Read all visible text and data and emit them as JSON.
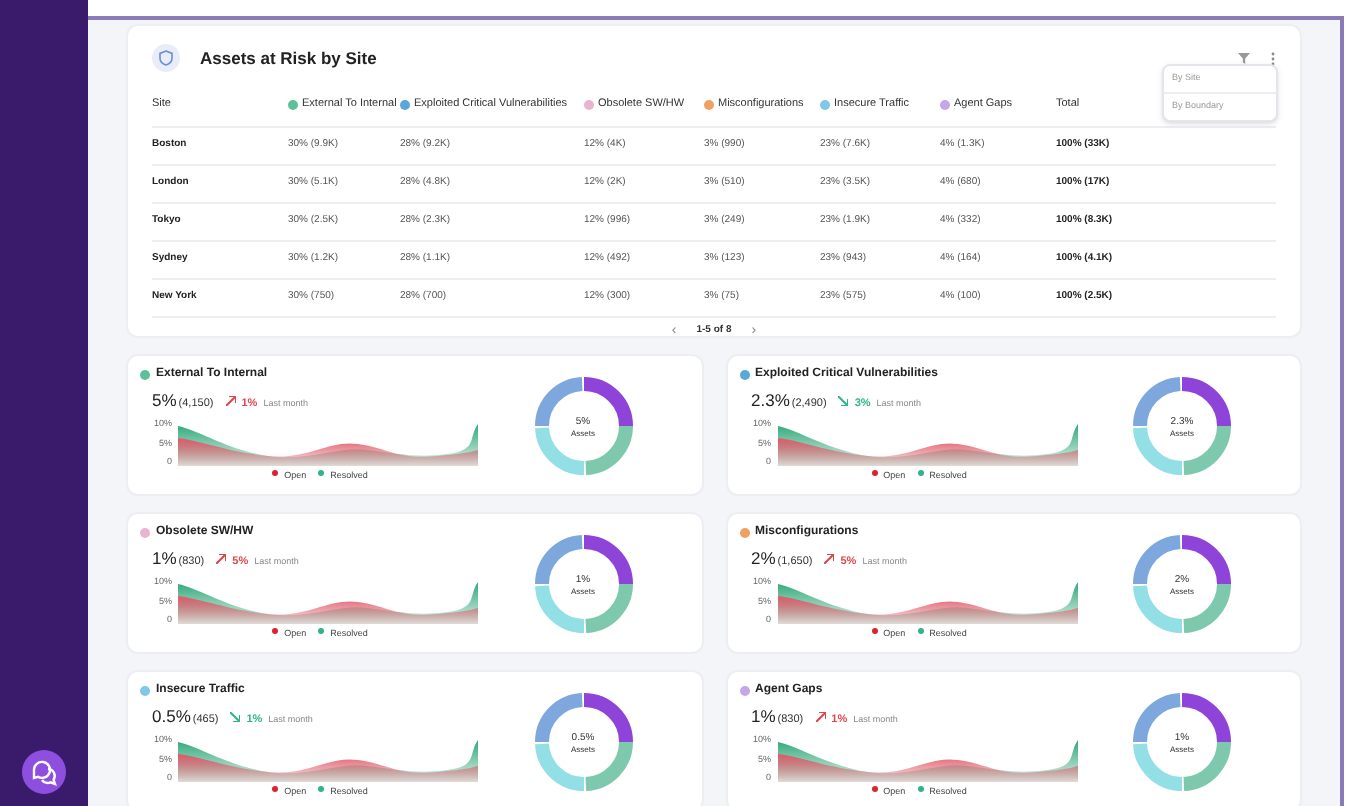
{
  "table_card": {
    "title": "Assets at Risk by Site",
    "columns": [
      {
        "label": "Site"
      },
      {
        "label": "External To Internal",
        "color": "#5cc19a"
      },
      {
        "label": "Exploited Critical Vulnerabilities",
        "color": "#5aa7d8"
      },
      {
        "label": "Obsolete SW/HW",
        "color": "#e8b4d0"
      },
      {
        "label": "Misconfigurations",
        "color": "#f0a060"
      },
      {
        "label": "Insecure Traffic",
        "color": "#7fc8e8"
      },
      {
        "label": "Agent Gaps",
        "color": "#c5a7e8"
      },
      {
        "label": "Total"
      }
    ],
    "rows": [
      [
        "Boston",
        "30% (9.9K)",
        "28% (9.2K)",
        "12% (4K)",
        "3% (990)",
        "23% (7.6K)",
        "4% (1.3K)",
        "100% (33K)"
      ],
      [
        "London",
        "30% (5.1K)",
        "28% (4.8K)",
        "12% (2K)",
        "3% (510)",
        "23% (3.5K)",
        "4% (680)",
        "100% (17K)"
      ],
      [
        "Tokyo",
        "30% (2.5K)",
        "28% (2.3K)",
        "12% (996)",
        "3% (249)",
        "23% (1.9K)",
        "4% (332)",
        "100% (8.3K)"
      ],
      [
        "Sydney",
        "30% (1.2K)",
        "28% (1.1K)",
        "12% (492)",
        "3% (123)",
        "23% (943)",
        "4% (164)",
        "100% (4.1K)"
      ],
      [
        "New York",
        "30% (750)",
        "28% (700)",
        "12% (300)",
        "3% (75)",
        "23% (575)",
        "4% (100)",
        "100% (2.5K)"
      ]
    ],
    "pagination": "1-5 of 8",
    "prev": "‹",
    "next": "›",
    "menu": [
      {
        "label": "By Site"
      },
      {
        "label": "By Boundary"
      }
    ]
  },
  "cards": [
    {
      "title": "External To Internal",
      "color": "#5cc19a",
      "value": "5%",
      "count": "(4,150)",
      "change": "1%",
      "rising": true,
      "period": "Last month",
      "center": "5%",
      "center_label": "Assets",
      "yticks": [
        "10%",
        "5%",
        "0"
      ],
      "legend": [
        "Open",
        "Resolved"
      ]
    },
    {
      "title": "Exploited Critical Vulnerabilities",
      "color": "#5aa7d8",
      "value": "2.3%",
      "count": "(2,490)",
      "change": "3%",
      "rising": false,
      "period": "Last month",
      "center": "2.3%",
      "center_label": "Assets",
      "yticks": [
        "10%",
        "5%",
        "0"
      ],
      "legend": [
        "Open",
        "Resolved"
      ]
    },
    {
      "title": "Obsolete SW/HW",
      "color": "#e8b4d0",
      "value": "1%",
      "count": "(830)",
      "change": "5%",
      "rising": true,
      "period": "Last month",
      "center": "1%",
      "center_label": "Assets",
      "yticks": [
        "10%",
        "5%",
        "0"
      ],
      "legend": [
        "Open",
        "Resolved"
      ]
    },
    {
      "title": "Misconfigurations",
      "color": "#f0a060",
      "value": "2%",
      "count": "(1,650)",
      "change": "5%",
      "rising": true,
      "period": "Last month",
      "center": "2%",
      "center_label": "Assets",
      "yticks": [
        "10%",
        "5%",
        "0"
      ],
      "legend": [
        "Open",
        "Resolved"
      ]
    },
    {
      "title": "Insecure Traffic",
      "color": "#7fc8e8",
      "value": "0.5%",
      "count": "(465)",
      "change": "1%",
      "rising": false,
      "period": "Last month",
      "center": "0.5%",
      "center_label": "Assets",
      "yticks": [
        "10%",
        "5%",
        "0"
      ],
      "legend": [
        "Open",
        "Resolved"
      ]
    },
    {
      "title": "Agent Gaps",
      "color": "#c5a7e8",
      "value": "1%",
      "count": "(830)",
      "change": "1%",
      "rising": true,
      "period": "Last month",
      "center": "1%",
      "center_label": "Assets",
      "yticks": [
        "10%",
        "5%",
        "0"
      ],
      "legend": [
        "Open",
        "Resolved"
      ]
    }
  ]
}
